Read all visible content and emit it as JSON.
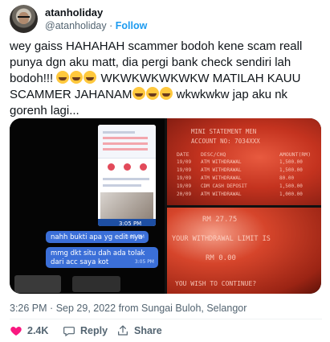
{
  "user": {
    "display_name": "atanholiday",
    "handle": "@atanholiday",
    "separator": "·",
    "follow_label": "Follow"
  },
  "tweet": {
    "line1": "wey gaiss HAHAHAH scammer bodoh kene scam reall punya dgn aku matt, dia pergi bank check sendiri lah bodoh!!! ",
    "line2": " WKWKWKWKWKW MATILAH KAUU SCAMMER JAHANAM",
    "line3": " wkwkwkw jap aku nk gorenh lagi...",
    "emoji": "rolling-on-floor-laughing"
  },
  "media": {
    "chat": {
      "time_chip": "3:05 PM",
      "bubble1": "nahh bukti apa yg edit nya",
      "bubble1_time": "3:05 PM",
      "bubble2": "mmg dkt situ dah ada tolak dari acc saya kot",
      "bubble2_time": "3:05 PM"
    },
    "statement": {
      "title": "MINI STATEMENT MEN",
      "account": "ACCOUNT NO: 7034XXX",
      "headers": [
        "DATE",
        "DESC/CHQ",
        "AMOUNT(RM)"
      ],
      "rows": [
        [
          "19/09",
          "ATM WITHDRAWAL",
          "1,500.00"
        ],
        [
          "19/09",
          "ATM WITHDRAWAL",
          "1,500.00"
        ],
        [
          "19/09",
          "ATM WITHDRAWAL",
          "80.00"
        ],
        [
          "19/09",
          "CDM CASH DEPOSIT",
          "1,500.00"
        ],
        [
          "20/09",
          "ATM WITHDRAWAL",
          "1,000.00"
        ]
      ]
    },
    "withdrawal": {
      "amount": "RM 27.75",
      "limit": "YOUR WITHDRAWAL LIMIT IS",
      "zero": "RM 0.00",
      "continue": "YOU WISH TO CONTINUE?"
    }
  },
  "meta": {
    "time": "3:26 PM",
    "date": "Sep 29, 2022",
    "from": "from Sungai Buloh, Selangor"
  },
  "actions": {
    "likes": "2.4K",
    "reply_label": "Reply",
    "share_label": "Share"
  },
  "colors": {
    "accent": "#1d9bf0",
    "heart": "#f91880",
    "muted": "#536471"
  }
}
